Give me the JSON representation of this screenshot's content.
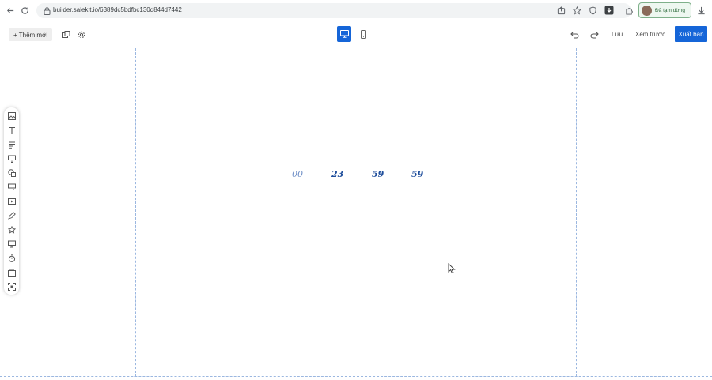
{
  "browser": {
    "url": "builder.salekit.io/6389dc5bdfbc130d844d7442",
    "paused_label": "Đã tạm dừng",
    "icons": [
      "back-icon",
      "reload-icon",
      "lock-icon",
      "share-icon",
      "star-icon",
      "shield-icon",
      "extension-download-icon",
      "puzzle-icon",
      "download-icon"
    ]
  },
  "toolbar": {
    "add_new_label": "+ Thêm mới",
    "save_label": "Lưu",
    "preview_label": "Xem trước",
    "publish_label": "Xuất bản",
    "accent_color": "#1565d8"
  },
  "sidebar_tools": [
    "image-icon",
    "text-icon",
    "paragraph-icon",
    "form-icon",
    "shapes-icon",
    "button-icon",
    "video-icon",
    "draw-icon",
    "star-icon",
    "slider-icon",
    "timer-icon",
    "gallery-icon",
    "frame-icon"
  ],
  "countdown": {
    "values": [
      "00",
      "23",
      "59",
      "59"
    ],
    "color": "#1f4e9c"
  }
}
